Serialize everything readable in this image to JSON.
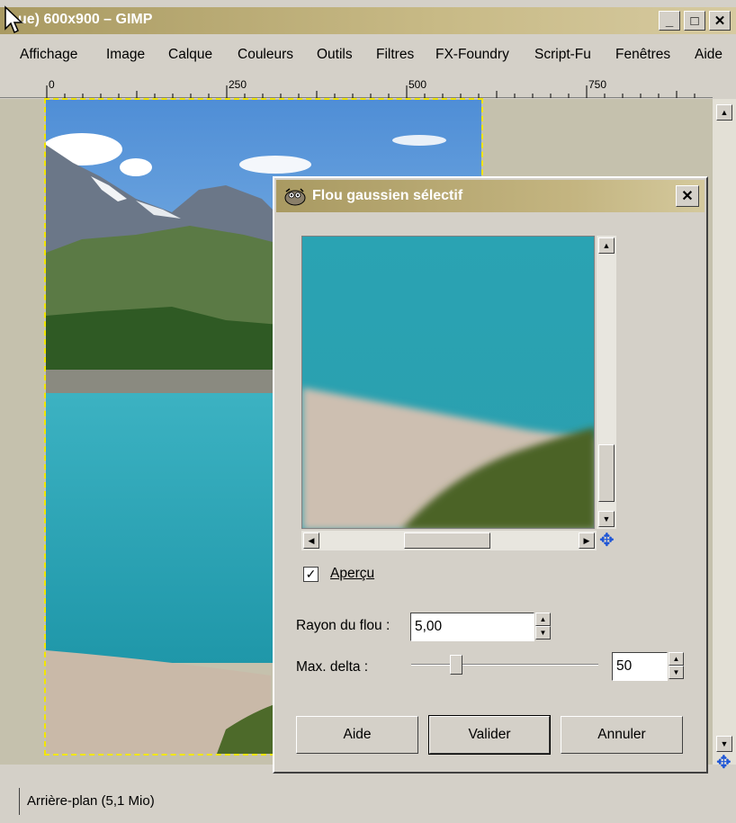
{
  "window": {
    "title": "ue) 600x900 – GIMP",
    "min_glyph": "_",
    "max_glyph": "□",
    "close_glyph": "✕"
  },
  "menu": [
    "Affichage",
    "Image",
    "Calque",
    "Couleurs",
    "Outils",
    "Filtres",
    "FX-Foundry",
    "Script-Fu",
    "Fenêtres",
    "Aide"
  ],
  "ruler": {
    "labels": [
      "0",
      "250",
      "500",
      "750"
    ]
  },
  "status": {
    "text": "Arrière-plan (5,1 Mio)"
  },
  "dialog": {
    "title": "Flou gaussien sélectif",
    "close_glyph": "✕",
    "preview_label": "Aperçu",
    "preview_checked": true,
    "radius_label": "Rayon du flou :",
    "radius_value": "5,00",
    "delta_label": "Max. delta :",
    "delta_value": "50",
    "delta_slider_fraction": 0.24,
    "buttons": {
      "help": "Aide",
      "ok": "Valider",
      "cancel": "Annuler"
    }
  },
  "colors": {
    "titlebar": "#a99a62",
    "move_icon": "#1f56d6",
    "selection": "#f2e600",
    "water": "#2aa4b5"
  }
}
